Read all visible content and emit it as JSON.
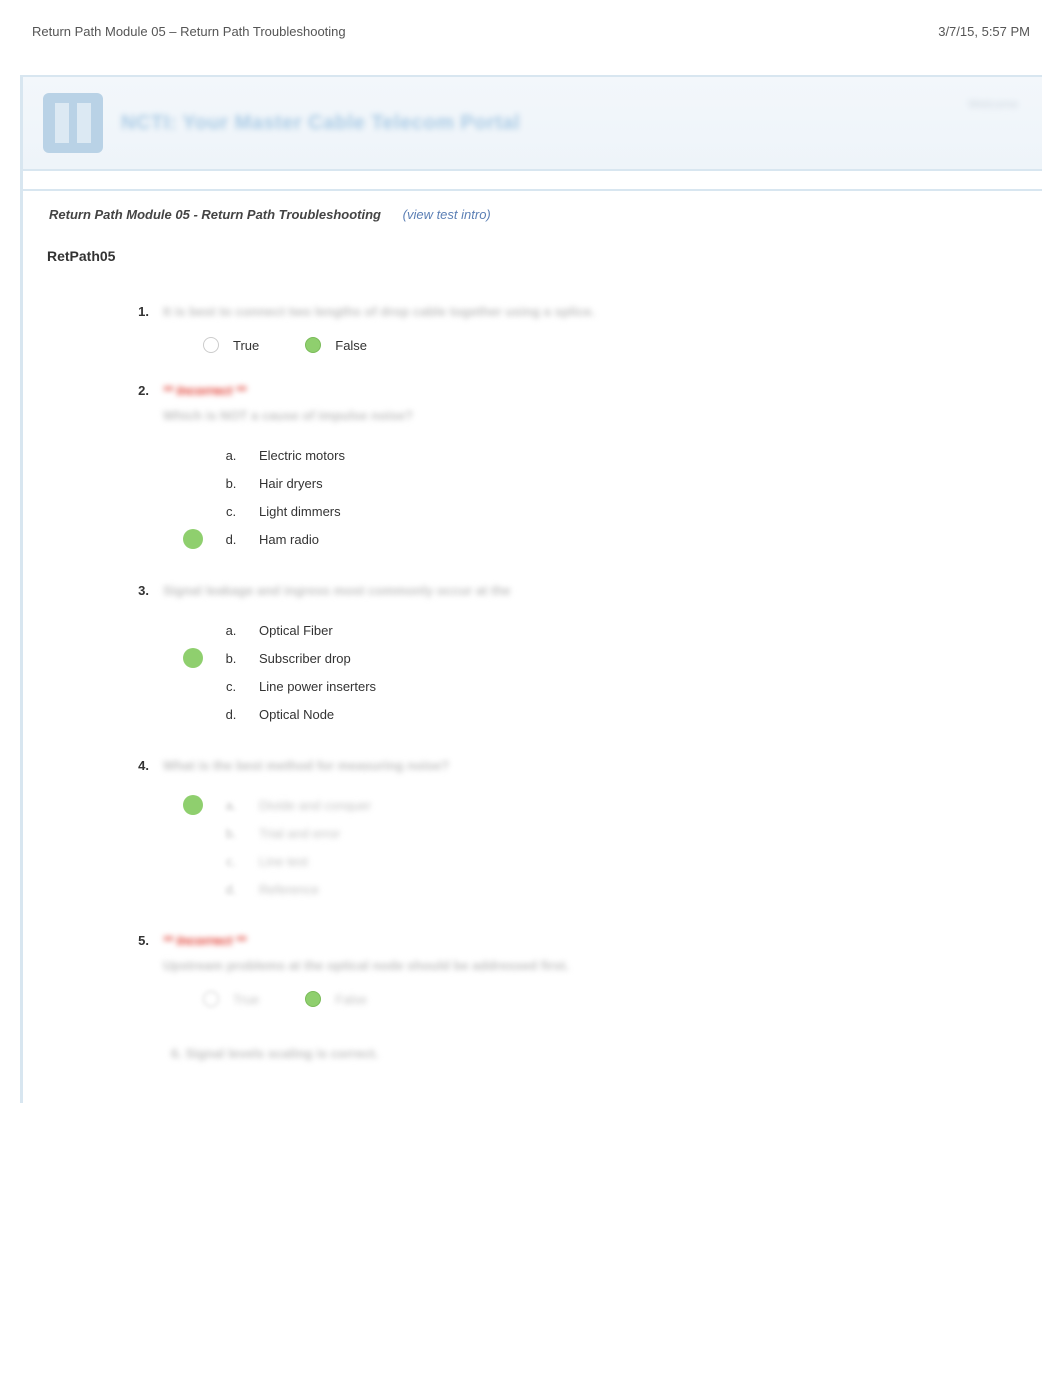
{
  "header": {
    "title": "Return Path Module 05 – Return Path Troubleshooting",
    "timestamp": "3/7/15, 5:57 PM"
  },
  "banner": {
    "title": "NCTI: Your Master Cable Telecom Portal",
    "right": "Welcome"
  },
  "breadcrumb": {
    "title": "Return Path Module 05 - Return Path Troubleshooting",
    "view_intro": "(view test intro)"
  },
  "section_code": "RetPath05",
  "questions": [
    {
      "num": "1.",
      "prompt": "It is best to connect two lengths of drop cable together using a splice.",
      "type": "tf",
      "options": [
        {
          "label": "True",
          "correct": false
        },
        {
          "label": "False",
          "correct": true
        }
      ]
    },
    {
      "num": "2.",
      "incorrect": "** Incorrect **",
      "prompt": "Which is NOT a cause of impulse noise?",
      "type": "mc",
      "options": [
        {
          "letter": "a.",
          "text": "Electric motors",
          "correct": false
        },
        {
          "letter": "b.",
          "text": "Hair dryers",
          "correct": false
        },
        {
          "letter": "c.",
          "text": "Light dimmers",
          "correct": false
        },
        {
          "letter": "d.",
          "text": "Ham radio",
          "correct": true
        }
      ]
    },
    {
      "num": "3.",
      "prompt": "Signal leakage and ingress most commonly occur at the",
      "type": "mc",
      "options": [
        {
          "letter": "a.",
          "text": "Optical Fiber",
          "correct": false
        },
        {
          "letter": "b.",
          "text": "Subscriber drop",
          "correct": true
        },
        {
          "letter": "c.",
          "text": "Line power inserters",
          "correct": false
        },
        {
          "letter": "d.",
          "text": "Optical Node",
          "correct": false
        }
      ]
    },
    {
      "num": "4.",
      "prompt": "What is the best method for measuring noise?",
      "type": "mc_blurred",
      "options": [
        {
          "letter": "a.",
          "text": "Divide and conquer",
          "correct": true
        },
        {
          "letter": "b.",
          "text": "Trial and error",
          "correct": false
        },
        {
          "letter": "c.",
          "text": "Line test",
          "correct": false
        },
        {
          "letter": "d.",
          "text": "Reference",
          "correct": false
        }
      ]
    },
    {
      "num": "5.",
      "incorrect": "** Incorrect **",
      "prompt": "Upstream problems at the optical node should be addressed first.",
      "type": "tf_blurred",
      "options": [
        {
          "label": "True",
          "correct": false
        },
        {
          "label": "False",
          "correct": true
        }
      ]
    }
  ],
  "trailing_question": "6.   Signal levels scaling is correct."
}
